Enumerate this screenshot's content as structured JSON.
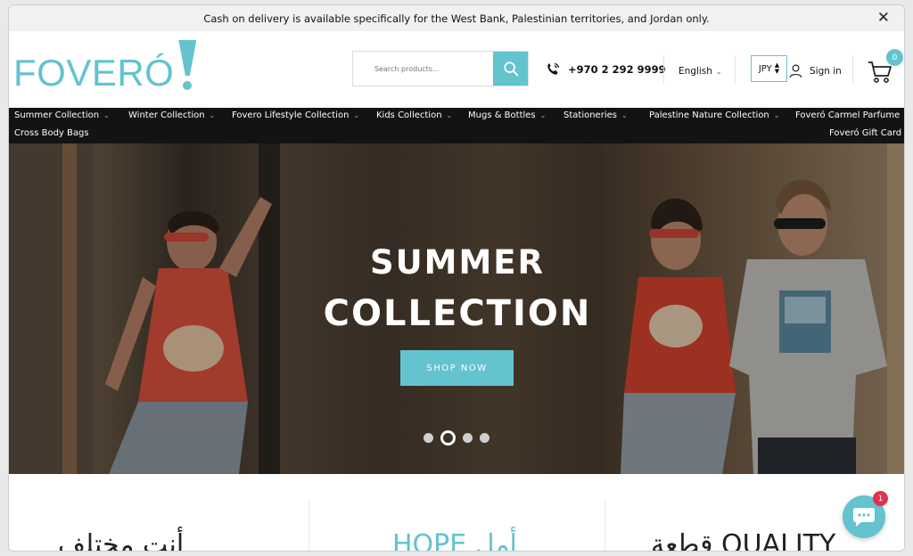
{
  "announcement": {
    "text": "Cash on delivery is available specifically for the West Bank, Palestinian territories, and Jordan only.",
    "close_icon": "close-icon"
  },
  "logo": {
    "text": "FOVERÓ"
  },
  "search": {
    "placeholder": "Search products...",
    "icon": "search-icon"
  },
  "phone": {
    "number": "+970 2 292 9999",
    "icon": "phone-icon"
  },
  "language": {
    "selected": "English"
  },
  "currency": {
    "selected": "JPY"
  },
  "account": {
    "signin_label": "Sign in",
    "icon": "user-icon"
  },
  "cart": {
    "count": "0",
    "icon": "cart-icon"
  },
  "nav": {
    "items": [
      {
        "label": "Summer Collection",
        "has_dropdown": true
      },
      {
        "label": "Winter Collection",
        "has_dropdown": true
      },
      {
        "label": "Fovero Lifestyle Collection",
        "has_dropdown": true
      },
      {
        "label": "Kids Collection",
        "has_dropdown": true
      },
      {
        "label": "Mugs & Bottles",
        "has_dropdown": true
      },
      {
        "label": "Stationeries",
        "has_dropdown": true
      },
      {
        "label": "Palestine Nature Collection",
        "has_dropdown": true
      },
      {
        "label": "Foveró Carmel Parfume",
        "has_dropdown": false
      },
      {
        "label": "Cross Body Bags",
        "has_dropdown": false
      },
      {
        "label": "Foveró Gift Card",
        "has_dropdown": false
      }
    ]
  },
  "hero": {
    "title_line1": "SUMMER",
    "title_line2": "COLLECTION",
    "cta_label": "SHOP NOW",
    "slide_count": 4,
    "active_slide": 2
  },
  "features": {
    "items": [
      {
        "text": "أنت مختلف"
      },
      {
        "text": "HOPE أمل"
      },
      {
        "text": "قطعة QUALITY"
      }
    ]
  },
  "chat": {
    "badge": "1",
    "icon": "chat-icon"
  },
  "colors": {
    "accent": "#63c3cf",
    "nav_bg": "#131313",
    "badge_red": "#e4304f"
  }
}
